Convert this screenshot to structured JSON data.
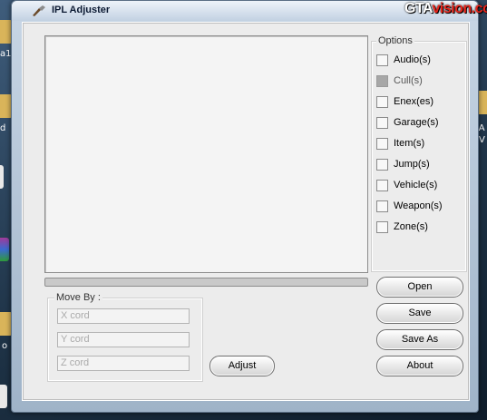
{
  "window": {
    "title": "IPL Adjuster",
    "watermark_part1": "GTA",
    "watermark_part2": "vision.com"
  },
  "desktop": {
    "labels": [
      "a1",
      "d",
      "o",
      "PL A",
      "V"
    ]
  },
  "options": {
    "title": "Options",
    "items": [
      {
        "label": "Audio(s)",
        "checked": false,
        "enabled": true
      },
      {
        "label": "Cull(s)",
        "checked": false,
        "enabled": false
      },
      {
        "label": "Enex(es)",
        "checked": false,
        "enabled": true
      },
      {
        "label": "Garage(s)",
        "checked": false,
        "enabled": true
      },
      {
        "label": "Item(s)",
        "checked": false,
        "enabled": true
      },
      {
        "label": "Jump(s)",
        "checked": false,
        "enabled": true
      },
      {
        "label": "Vehicle(s)",
        "checked": false,
        "enabled": true
      },
      {
        "label": "Weapon(s)",
        "checked": false,
        "enabled": true
      },
      {
        "label": "Zone(s)",
        "checked": false,
        "enabled": true
      }
    ]
  },
  "move_by": {
    "title": "Move By :",
    "x_placeholder": "X cord",
    "y_placeholder": "Y cord",
    "z_placeholder": "Z cord"
  },
  "buttons": {
    "adjust": "Adjust",
    "open": "Open",
    "save": "Save",
    "save_as": "Save As",
    "about": "About"
  },
  "progress": {
    "value": 0
  },
  "colors": {
    "accent": "#5ea3ea",
    "watermark_red": "#e8251c"
  }
}
